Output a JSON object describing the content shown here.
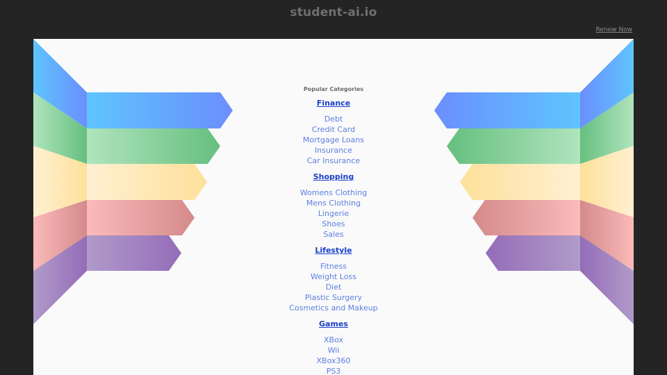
{
  "header": {
    "site_title": "student-ai.io",
    "renew_label": "Renew Now"
  },
  "main": {
    "popular_label": "Popular Categories",
    "categories": [
      {
        "title": "Finance",
        "links": [
          "Debt",
          "Credit Card",
          "Mortgage Loans",
          "Insurance",
          "Car Insurance"
        ]
      },
      {
        "title": "Shopping",
        "links": [
          "Womens Clothing",
          "Mens Clothing",
          "Lingerie",
          "Shoes",
          "Sales"
        ]
      },
      {
        "title": "Lifestyle",
        "links": [
          "Fitness",
          "Weight Loss",
          "Diet",
          "Plastic Surgery",
          "Cosmetics and Makeup"
        ]
      },
      {
        "title": "Games",
        "links": [
          "XBox",
          "Wii",
          "XBox360",
          "PS3"
        ]
      }
    ]
  },
  "decoration": {
    "ribbons": [
      {
        "name": "blue",
        "light": "#5fc4fe",
        "dark": "#6a8ffd"
      },
      {
        "name": "green",
        "light": "#b0e4bd",
        "dark": "#66bf7f"
      },
      {
        "name": "yellow",
        "light": "#fff0d2",
        "dark": "#fde09a"
      },
      {
        "name": "pink",
        "light": "#fbbabb",
        "dark": "#d48a8a"
      },
      {
        "name": "purple",
        "light": "#b09bc9",
        "dark": "#946cb8"
      }
    ]
  }
}
